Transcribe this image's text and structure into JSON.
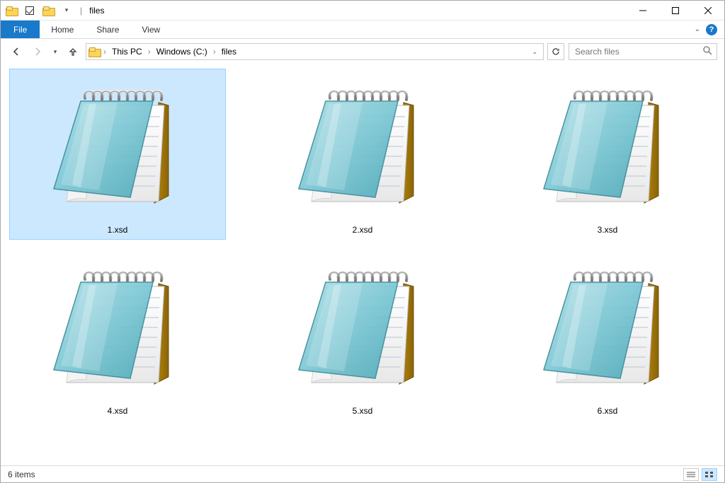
{
  "titlebar": {
    "title": "files",
    "separator": "|"
  },
  "ribbon": {
    "file": "File",
    "tabs": [
      "Home",
      "Share",
      "View"
    ]
  },
  "breadcrumb": {
    "segments": [
      "This PC",
      "Windows (C:)",
      "files"
    ]
  },
  "search": {
    "placeholder": "Search files"
  },
  "files": [
    {
      "name": "1.xsd",
      "selected": true
    },
    {
      "name": "2.xsd",
      "selected": false
    },
    {
      "name": "3.xsd",
      "selected": false
    },
    {
      "name": "4.xsd",
      "selected": false
    },
    {
      "name": "5.xsd",
      "selected": false
    },
    {
      "name": "6.xsd",
      "selected": false
    }
  ],
  "statusbar": {
    "count_label": "6 items"
  }
}
